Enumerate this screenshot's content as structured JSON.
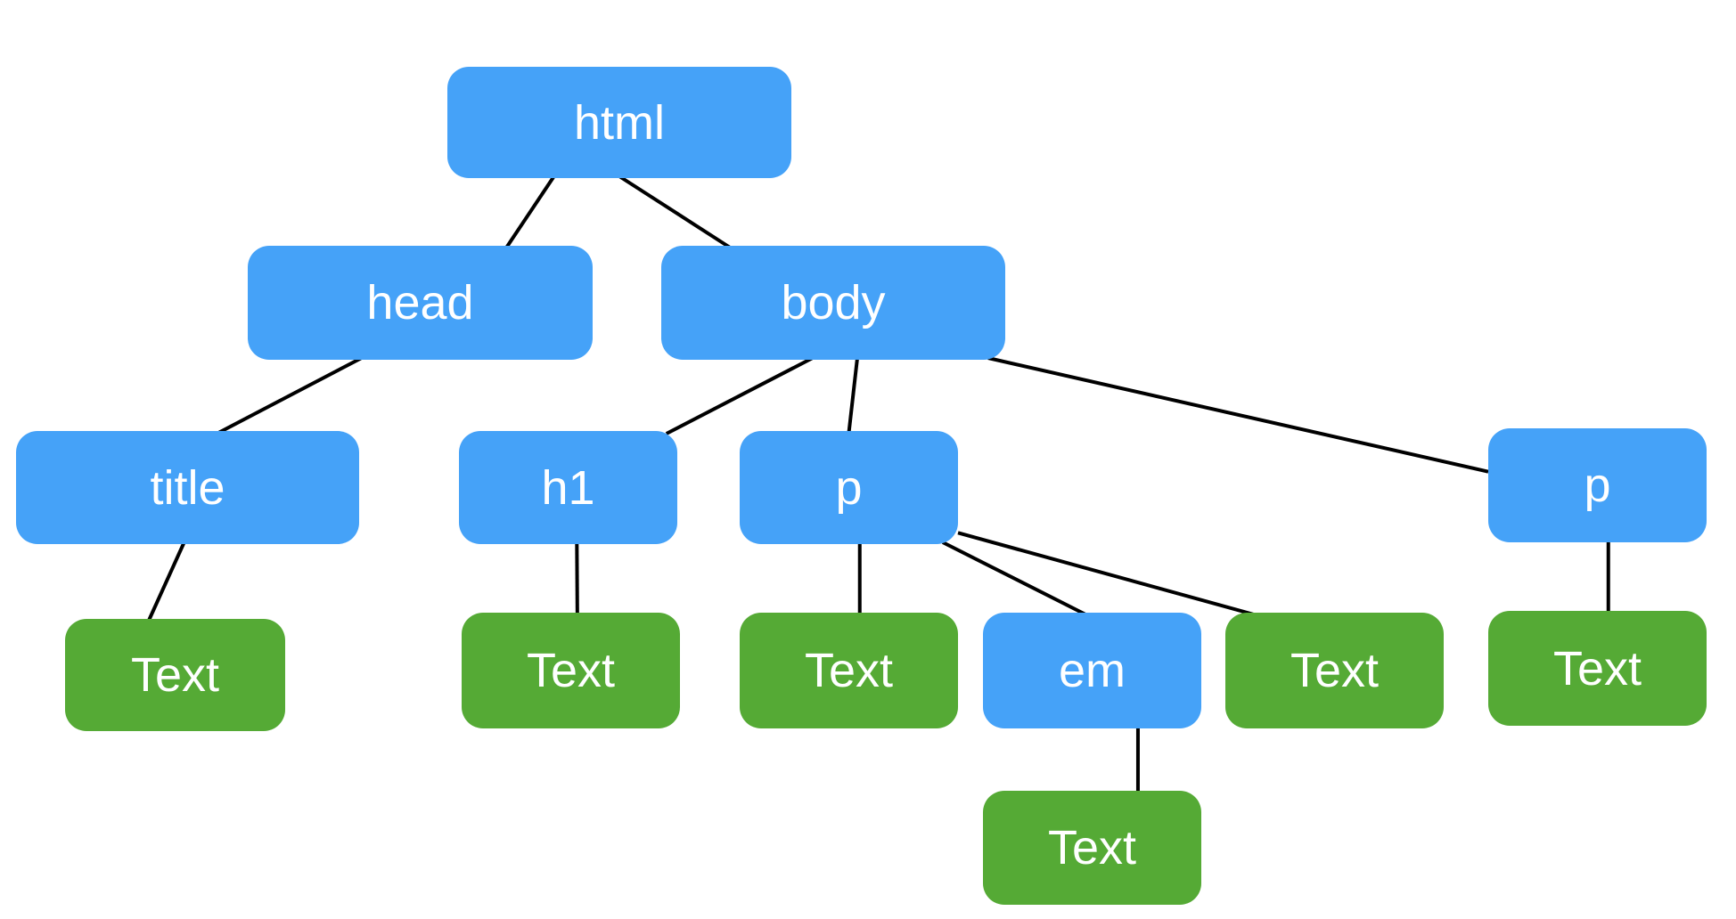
{
  "diagram": {
    "type": "DOM tree",
    "colors": {
      "element_node": "#45A2F8",
      "text_node": "#55AA35",
      "connector": "#000000",
      "label": "#FFFFFF"
    },
    "nodes": {
      "html": {
        "label": "html",
        "kind": "element"
      },
      "head": {
        "label": "head",
        "kind": "element"
      },
      "body": {
        "label": "body",
        "kind": "element"
      },
      "title": {
        "label": "title",
        "kind": "element"
      },
      "h1": {
        "label": "h1",
        "kind": "element"
      },
      "p1": {
        "label": "p",
        "kind": "element"
      },
      "p2": {
        "label": "p",
        "kind": "element"
      },
      "em": {
        "label": "em",
        "kind": "element"
      },
      "t_title": {
        "label": "Text",
        "kind": "text"
      },
      "t_h1": {
        "label": "Text",
        "kind": "text"
      },
      "t_p1a": {
        "label": "Text",
        "kind": "text"
      },
      "t_em": {
        "label": "Text",
        "kind": "text"
      },
      "t_p1b": {
        "label": "Text",
        "kind": "text"
      },
      "t_p2": {
        "label": "Text",
        "kind": "text"
      }
    },
    "edges": [
      [
        "html",
        "head"
      ],
      [
        "html",
        "body"
      ],
      [
        "head",
        "title"
      ],
      [
        "body",
        "h1"
      ],
      [
        "body",
        "p1"
      ],
      [
        "body",
        "p2"
      ],
      [
        "title",
        "t_title"
      ],
      [
        "h1",
        "t_h1"
      ],
      [
        "p1",
        "t_p1a"
      ],
      [
        "p1",
        "em"
      ],
      [
        "p1",
        "t_p1b"
      ],
      [
        "p2",
        "t_p2"
      ],
      [
        "em",
        "t_em"
      ]
    ]
  }
}
